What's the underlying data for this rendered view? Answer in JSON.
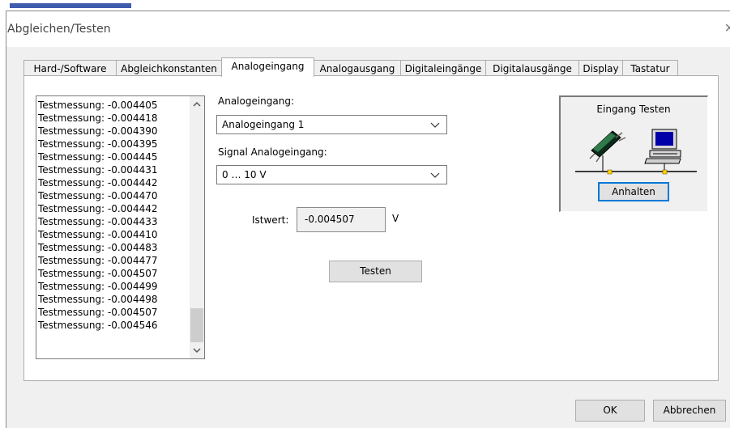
{
  "window": {
    "title": "Abgleichen/Testen",
    "close_glyph": "×"
  },
  "tabs": [
    {
      "label": "Hard-/Software"
    },
    {
      "label": "Abgleichkonstanten"
    },
    {
      "label": "Analogeingang"
    },
    {
      "label": "Analogausgang"
    },
    {
      "label": "Digitaleingänge"
    },
    {
      "label": "Digitalausgänge"
    },
    {
      "label": "Display"
    },
    {
      "label": "Tastatur"
    }
  ],
  "active_tab": "Analogeingang",
  "log": {
    "items": [
      "Testmessung: -0.004405",
      "Testmessung: -0.004418",
      "Testmessung: -0.004390",
      "Testmessung: -0.004395",
      "Testmessung: -0.004445",
      "Testmessung: -0.004431",
      "Testmessung: -0.004442",
      "Testmessung: -0.004470",
      "Testmessung: -0.004442",
      "Testmessung: -0.004433",
      "Testmessung: -0.004410",
      "Testmessung: -0.004483",
      "Testmessung: -0.004477",
      "Testmessung: -0.004507",
      "Testmessung: -0.004499",
      "Testmessung: -0.004498",
      "Testmessung: -0.004507",
      "Testmessung: -0.004546"
    ],
    "scroll_up_icon": "chevron-up-icon",
    "scroll_down_icon": "chevron-down-icon"
  },
  "analog_input": {
    "label": "Analogeingang:",
    "selected": "Analogeingang 1"
  },
  "signal": {
    "label": "Signal Analogeingang:",
    "selected": "0 … 10 V"
  },
  "istwert": {
    "label": "Istwert:",
    "value": "-0.004507",
    "unit": "V"
  },
  "test_button": "Testen",
  "eingang_testen": {
    "title": "Eingang Testen",
    "button": "Anhalten",
    "chip_icon": "chip-icon",
    "computer_icon": "computer-icon"
  },
  "footer": {
    "ok": "OK",
    "cancel": "Abbrechen"
  },
  "colors": {
    "dialog_bg": "#f0f0f0",
    "button_bg": "#e1e1e1",
    "accent_blue": "#0078d7",
    "network_yellow": "#ffd700"
  }
}
